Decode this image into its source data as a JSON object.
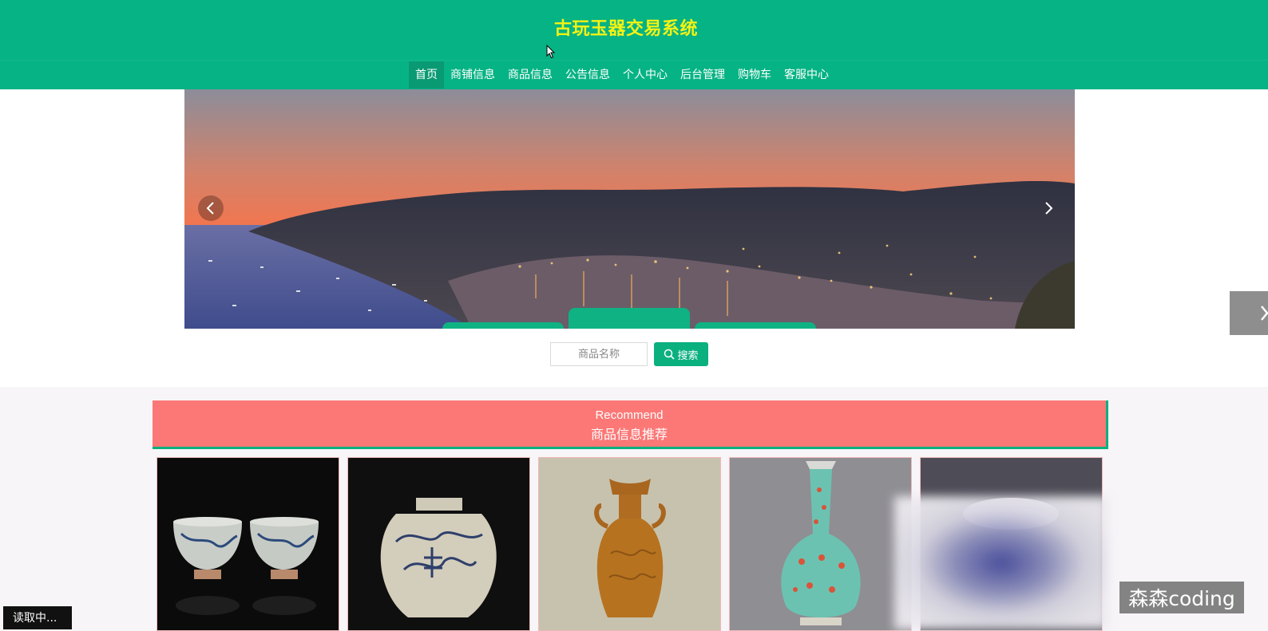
{
  "header": {
    "title": "古玩玉器交易系统"
  },
  "nav": {
    "items": [
      {
        "label": "首页",
        "active": true
      },
      {
        "label": "商铺信息"
      },
      {
        "label": "商品信息"
      },
      {
        "label": "公告信息"
      },
      {
        "label": "个人中心"
      },
      {
        "label": "后台管理"
      },
      {
        "label": "购物车"
      },
      {
        "label": "客服中心"
      }
    ]
  },
  "carousel": {
    "prev_icon": "chevron-left-icon",
    "next_icon": "chevron-right-icon",
    "active_dot": 1
  },
  "search": {
    "placeholder": "商品名称",
    "button_label": "搜索",
    "icon": "search-icon"
  },
  "recommend": {
    "title_en": "Recommend",
    "title_cn": "商品信息推荐"
  },
  "side_tab": {
    "icon": "chevron-right-icon"
  },
  "overlay": {
    "watermark": "森森coding",
    "loading": "读取中..."
  },
  "colors": {
    "primary": "#06b384",
    "title": "#f4f214",
    "recommend": "#fb7876"
  }
}
